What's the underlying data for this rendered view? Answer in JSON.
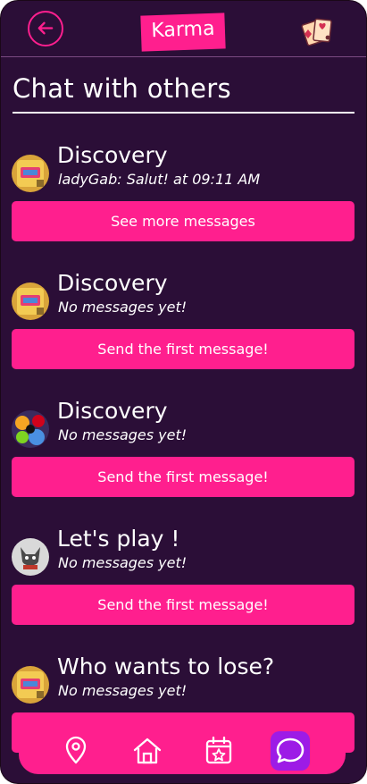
{
  "app": {
    "logo_text": "Karma"
  },
  "header": {
    "back_icon": "arrow-left-circle-icon",
    "cards_icon": "playing-cards-icon"
  },
  "page": {
    "title": "Chat with others"
  },
  "chats": [
    {
      "name": "Discovery",
      "preview": "ladyGab: Salut! at 09:11 AM",
      "button_label": "See more messages",
      "avatar": "game-box-avatar"
    },
    {
      "name": "Discovery",
      "preview": "No messages yet!",
      "button_label": "Send the first message!",
      "avatar": "game-box-avatar"
    },
    {
      "name": "Discovery",
      "preview": "No messages yet!",
      "button_label": "Send the first message!",
      "avatar": "colorful-game-avatar"
    },
    {
      "name": "Let's play !",
      "preview": "No messages yet!",
      "button_label": "Send the first message!",
      "avatar": "dog-avatar"
    },
    {
      "name": "Who wants to lose?",
      "preview": "No messages yet!",
      "button_label": "",
      "avatar": "game-box-avatar"
    }
  ],
  "nav": {
    "items": [
      {
        "icon": "map-pin-icon",
        "active": false
      },
      {
        "icon": "home-icon",
        "active": false
      },
      {
        "icon": "calendar-star-icon",
        "active": false
      },
      {
        "icon": "chat-bubble-icon",
        "active": true
      }
    ]
  },
  "colors": {
    "background": "#2b0e37",
    "accent": "#ff1f8e",
    "active_nav": "#9d1be6",
    "text": "#ffffff"
  }
}
